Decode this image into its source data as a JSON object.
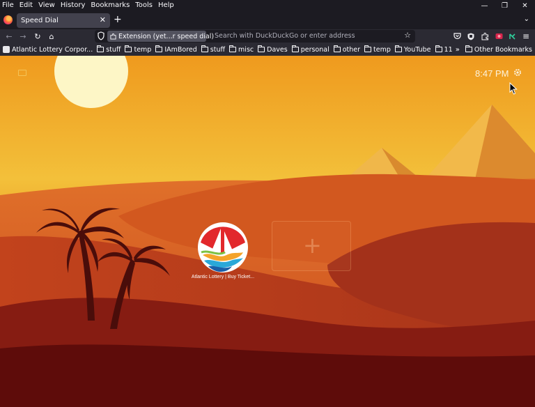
{
  "menubar": {
    "items": [
      "File",
      "Edit",
      "View",
      "History",
      "Bookmarks",
      "Tools",
      "Help"
    ],
    "window_controls": {
      "minimize": "—",
      "maximize": "❐",
      "close": "✕"
    }
  },
  "tabs": {
    "active_title": "Speed Dial",
    "close_glyph": "✕",
    "new_tab_glyph": "+",
    "list_glyph": "⌄"
  },
  "navbar": {
    "extension_label": "Extension (yet...r speed dial)",
    "url_placeholder": "Search with DuckDuckGo or enter address",
    "back_glyph": "←",
    "forward_glyph": "→",
    "reload_glyph": "↻",
    "home_glyph": "⌂",
    "star_glyph": "☆",
    "menu_glyph": "≡"
  },
  "bookmarks": {
    "items": [
      {
        "label": "Atlantic Lottery Corpor...",
        "type": "page"
      },
      {
        "label": "stuff",
        "type": "folder"
      },
      {
        "label": "temp",
        "type": "folder"
      },
      {
        "label": "IAmBored",
        "type": "folder"
      },
      {
        "label": "stuff",
        "type": "folder"
      },
      {
        "label": "misc",
        "type": "folder"
      },
      {
        "label": "Daves",
        "type": "folder"
      },
      {
        "label": "personal",
        "type": "folder"
      },
      {
        "label": "other",
        "type": "folder"
      },
      {
        "label": "temp",
        "type": "folder"
      },
      {
        "label": "YouTube",
        "type": "folder"
      },
      {
        "label": "11",
        "type": "folder"
      }
    ],
    "overflow_glyph": "»",
    "other_label": "Other Bookmarks"
  },
  "speed_dial": {
    "clock": "8:47 PM",
    "dials": [
      {
        "label": "Atlantic Lottery | Buy Ticket..."
      }
    ],
    "add_glyph": "+"
  },
  "colors": {
    "sky_top": "#ee9a1c",
    "sky_bottom": "#f2c23c",
    "sun": "#fdf6c6",
    "dune_dark": "#6a0f0b",
    "dune_mid": "#b3361a",
    "pyramid": "#e8a53a",
    "palm": "#4a0d0a"
  }
}
